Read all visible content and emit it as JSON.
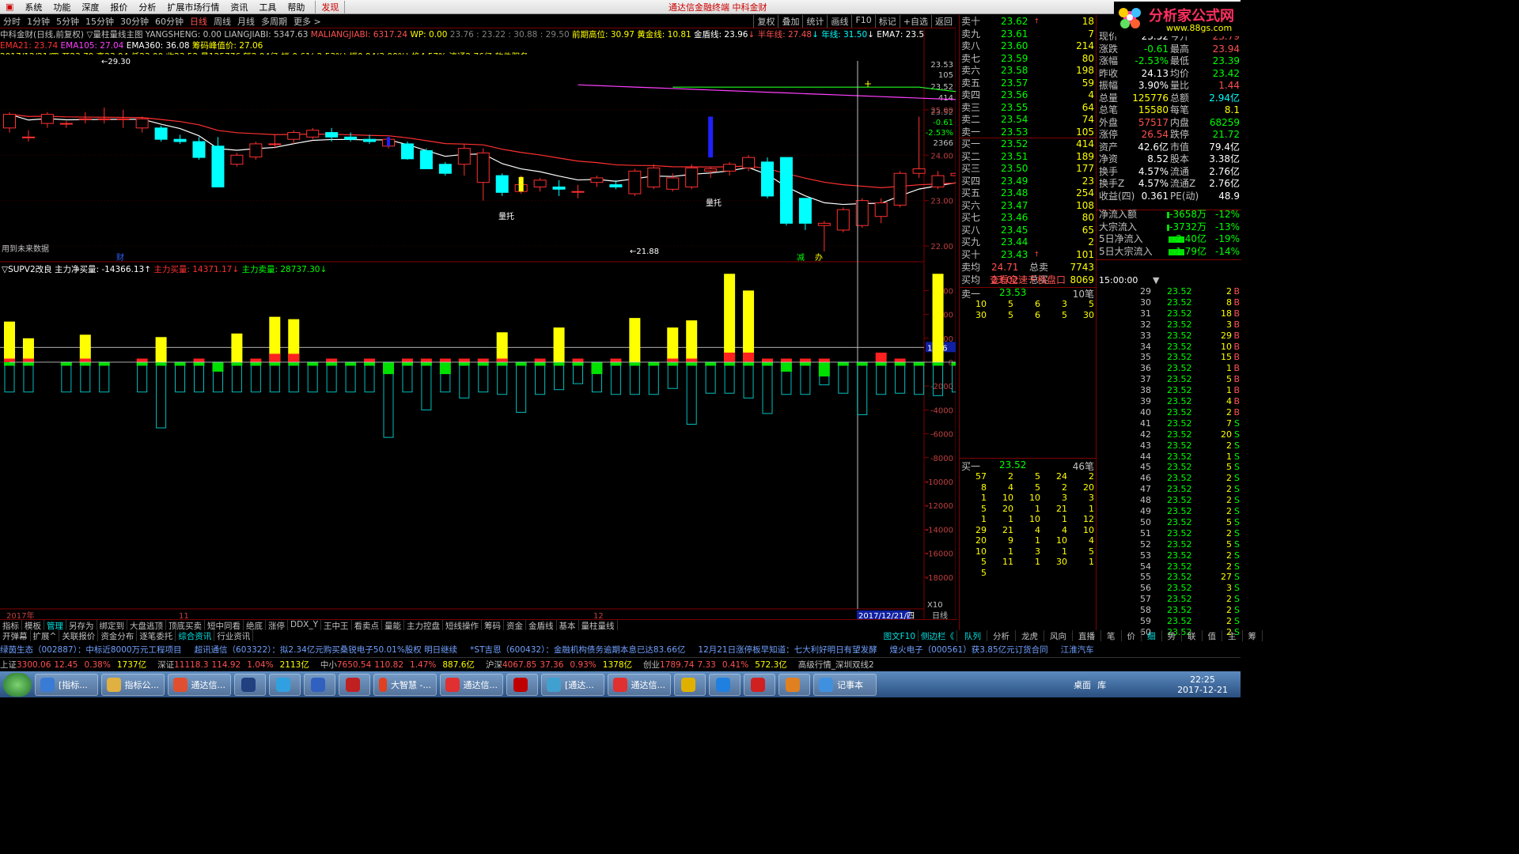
{
  "menu": {
    "items": [
      "系统",
      "功能",
      "深度",
      "报价",
      "分析",
      "扩展市场行情",
      "资讯",
      "工具",
      "帮助"
    ],
    "find": "发现",
    "title": "通达信金融终端  中科金财"
  },
  "period": {
    "items": [
      "分时",
      "1分钟",
      "5分钟",
      "15分钟",
      "30分钟",
      "60分钟",
      "日线",
      "周线",
      "月线",
      "多周期",
      "更多 >"
    ],
    "active": "日线",
    "tools": [
      "复权",
      "叠加",
      "统计",
      "画线",
      "F10",
      "标记",
      "+自选",
      "返回"
    ]
  },
  "info": {
    "line1": [
      {
        "t": "中科金财(日线,前复权) ▽量柱量线主图 YANGSHENG: 0.00  LIANGJIABI: 5347.63",
        "c": "#c0c0c0"
      },
      {
        "t": "  MALIANGJIABI: 6317.24",
        "c": "#ff5050"
      },
      {
        "t": "  WP: 0.00",
        "c": "#ffff00"
      },
      {
        "t": "   23.76 : 23.22 : 30.88 : 29.50",
        "c": "#808080"
      },
      {
        "t": "       前期高位: 30.97",
        "c": "#ffff00"
      },
      {
        "t": "     黄金线: 10.81",
        "c": "#ffff00"
      },
      {
        "t": "       金盾线: 23.96",
        "c": "#ffffff"
      },
      {
        "t": "↓ 半年线: 27.48",
        "c": "#ff5050"
      },
      {
        "t": "↓ 年线: 31.50",
        "c": "#00ffff"
      },
      {
        "t": "↓    EMA7: 23.59",
        "c": "#ffffff"
      },
      {
        "t": "↓ ◇ ◎",
        "c": "#ff5050"
      }
    ],
    "line2": [
      {
        "t": "EMA21: 23.74",
        "c": "#ff3030"
      },
      {
        "t": "   EMA105: 27.04",
        "c": "#ff40ff"
      },
      {
        "t": "   EMA360: 36.08",
        "c": "#ffffff"
      },
      {
        "t": "   筹码峰值价: 27.06",
        "c": "#ffff00"
      }
    ],
    "line3": [
      {
        "t": "2017/12/21/四 开23.79 高23.94 低23.00 收23.52 量125776 额2.94亿 幅-0.61(-2.53%) 振0.94(3.90%) 换4.57% 流通2.76亿 软件服务",
        "c": "#ffff00"
      }
    ]
  },
  "marks": {
    "hi": "←29.30",
    "lo": "←21.88",
    "liangtuo1": "量托",
    "liangtuo2": "量托",
    "future": "用到未来数据",
    "cai": "财",
    "jian": "减",
    "ban": "办"
  },
  "y_main": [
    "23.53",
    "105",
    "23.52",
    "414",
    "23.52",
    "-0.61",
    "-2.53%",
    "2366",
    "25.00",
    "24.00",
    "23.00",
    "22.00"
  ],
  "sub": {
    "title": "▽SUPV2改良  主力净买量: -14366.13↑",
    "buy": "  主力买量: 14371.17↓",
    "sell": "  主力卖量: 28737.30↓",
    "ticks": [
      "6000",
      "4000",
      "2000",
      "0",
      "-2000",
      "-4000",
      "-6000",
      "-8000",
      "-10000",
      "-12000",
      "-14000",
      "-16000",
      "-18000"
    ],
    "cur": "1236",
    "x10": "X10"
  },
  "x_axis": {
    "year": "2017年",
    "m11": "11",
    "m12": "12",
    "date": "2017/12/21/四",
    "day": "日线"
  },
  "chart_data": {
    "type": "candlestick",
    "title": "中科金财(日线,前复权)",
    "open": [
      24.6,
      24.4,
      24.7,
      24.7,
      24.8,
      24.8,
      24.8,
      24.6,
      24.6,
      24.35,
      24.3,
      24.2,
      23.8,
      23.96,
      24.25,
      24.35,
      24.4,
      24.5,
      24.4,
      24.35,
      24.2,
      24.25,
      24.1,
      23.8,
      23.8,
      23.4,
      23.55,
      23.2,
      23.3,
      23.3,
      23.2,
      23.4,
      23.35,
      23.15,
      23.3,
      23.25,
      23.3,
      23.65,
      23.65,
      23.72,
      23.85,
      23.95,
      23.05,
      22.45,
      22.35,
      22.45,
      22.65,
      22.9,
      23.6,
      23.3,
      23.55,
      23.6,
      23.7,
      23.7,
      23.6,
      23.85,
      23.3,
      23.1,
      24.3,
      23.52
    ],
    "close": [
      24.9,
      24.4,
      24.9,
      24.7,
      24.8,
      24.8,
      24.8,
      24.8,
      24.35,
      24.3,
      23.95,
      23.3,
      24,
      24.25,
      24.25,
      24.5,
      24.55,
      24.4,
      24.35,
      24.3,
      24.35,
      23.92,
      23.7,
      23.6,
      24.15,
      24.05,
      23.18,
      23.35,
      23.45,
      23.25,
      23.2,
      23.5,
      23.3,
      23.65,
      23.72,
      23.5,
      23.72,
      23.7,
      23.8,
      23.95,
      23.1,
      22.5,
      22.5,
      22.5,
      22.8,
      23.0,
      22.95,
      23.6,
      23.7,
      23.55,
      23.6,
      23.65,
      23.65,
      23.6,
      23.35,
      23.6,
      22.75,
      23.1,
      24.55,
      23.52
    ],
    "high": [
      24.95,
      24.55,
      24.95,
      24.75,
      24.95,
      25.05,
      25.0,
      24.85,
      24.65,
      24.45,
      24.4,
      24.4,
      24.05,
      24.3,
      24.45,
      24.55,
      24.6,
      24.6,
      24.5,
      24.45,
      24.4,
      24.3,
      24.15,
      23.85,
      24.25,
      24.15,
      23.6,
      23.55,
      23.5,
      23.45,
      23.35,
      23.55,
      23.45,
      23.7,
      23.8,
      23.6,
      23.8,
      23.75,
      23.85,
      24.0,
      23.95,
      23.0,
      22.55,
      22.55,
      22.85,
      23.05,
      23.05,
      23.65,
      24.85,
      23.65,
      24.3,
      23.7,
      23.95,
      23.75,
      23.65,
      23.9,
      23.45,
      24.55,
      24.62,
      23.94
    ],
    "low": [
      24.5,
      24.3,
      24.6,
      24.6,
      24.7,
      24.7,
      24.6,
      24.5,
      24.3,
      24.25,
      23.9,
      23.3,
      23.75,
      23.9,
      24.15,
      24.25,
      24.35,
      24.3,
      24.3,
      24.25,
      24.15,
      23.9,
      23.7,
      23.55,
      23.55,
      23.0,
      23.1,
      23.15,
      23.2,
      23.1,
      23.05,
      23.3,
      23.25,
      23.1,
      23.25,
      23.2,
      23.25,
      23.5,
      23.55,
      23.65,
      23.05,
      22.45,
      22.35,
      21.88,
      22.3,
      22.4,
      22.5,
      22.85,
      23.5,
      23.25,
      23.5,
      23.5,
      23.6,
      23.55,
      23.25,
      23.4,
      22.7,
      22.9,
      23.6,
      23.0
    ],
    "series": [
      {
        "name": "EMA7",
        "color": "#ffffff",
        "ema": 7
      },
      {
        "name": "EMA21",
        "color": "#ff3030",
        "ema": 21
      },
      {
        "name": "EMA105",
        "color": "#ff40ff",
        "values": [
          {
            "from": 30,
            "to": 59,
            "a": 25.55,
            "b": 25.08
          }
        ]
      },
      {
        "name": "金盾线",
        "color": "#20ff20",
        "values": [
          {
            "from": 35,
            "to": 59,
            "a": 25.5,
            "b": 25.08
          }
        ]
      }
    ],
    "sub_buy": [
      3400,
      2000,
      0,
      0,
      2300,
      0,
      0,
      0,
      2100,
      0,
      0,
      0,
      2400,
      0,
      3800,
      3600,
      0,
      0,
      0,
      0,
      0,
      0,
      0,
      0,
      0,
      0,
      2500,
      0,
      0,
      2900,
      0,
      0,
      0,
      3700,
      0,
      2900,
      3500,
      0,
      7400,
      6000,
      0,
      0,
      0,
      0,
      0,
      0,
      0,
      0,
      0,
      7400,
      0,
      0,
      0,
      0,
      0,
      0,
      0,
      0,
      0,
      0
    ],
    "sub_red": [
      300,
      300,
      0,
      0,
      300,
      0,
      0,
      300,
      0,
      0,
      300,
      0,
      0,
      300,
      700,
      700,
      0,
      300,
      0,
      300,
      0,
      300,
      300,
      300,
      300,
      300,
      300,
      0,
      300,
      0,
      300,
      0,
      300,
      0,
      0,
      300,
      300,
      0,
      800,
      800,
      300,
      300,
      300,
      300,
      0,
      0,
      800,
      300,
      0,
      0,
      0,
      0,
      0,
      7400,
      2400,
      1400,
      0,
      0,
      0,
      0
    ],
    "sub_green": [
      -300,
      -300,
      0,
      -300,
      -300,
      -300,
      0,
      -300,
      -300,
      -300,
      -300,
      -800,
      -300,
      -300,
      -300,
      -300,
      -300,
      -300,
      -300,
      -300,
      -1000,
      -300,
      -300,
      -1000,
      -300,
      -300,
      -300,
      -300,
      -300,
      -300,
      -300,
      -1000,
      -300,
      -300,
      -300,
      -300,
      -300,
      -300,
      -300,
      -300,
      -300,
      -800,
      -300,
      -1200,
      -300,
      -300,
      -300,
      -300,
      -300,
      -300,
      -300,
      -300,
      -300,
      -7700,
      -4800,
      -2900,
      0,
      0,
      0,
      0
    ],
    "sub_cyan": [
      -2500,
      -2500,
      0,
      -2500,
      -2500,
      -2500,
      0,
      -2500,
      -5500,
      -2500,
      -2500,
      -2500,
      -2500,
      -2500,
      -2500,
      -2500,
      -2500,
      -2500,
      -2500,
      -2500,
      -6300,
      -2500,
      -4000,
      -2500,
      -3000,
      -2500,
      -2700,
      -4200,
      -2700,
      -2300,
      -1800,
      -2500,
      -2700,
      -2700,
      -2700,
      -2200,
      -5200,
      -2600,
      -2600,
      -3000,
      -4300,
      -2700,
      -2700,
      -1900,
      -2600,
      -4400,
      -2700,
      -2600,
      -2700,
      -2800,
      -2500,
      -2400,
      -4100,
      -20000,
      -13300,
      -12700,
      0,
      0,
      0,
      0
    ]
  },
  "orderbook": {
    "sell": [
      {
        "l": "卖十",
        "p": "23.62",
        "v": "18",
        "f": "†"
      },
      {
        "l": "卖九",
        "p": "23.61",
        "v": "7"
      },
      {
        "l": "卖八",
        "p": "23.60",
        "v": "214"
      },
      {
        "l": "卖七",
        "p": "23.59",
        "v": "80"
      },
      {
        "l": "卖六",
        "p": "23.58",
        "v": "198"
      },
      {
        "l": "卖五",
        "p": "23.57",
        "v": "59"
      },
      {
        "l": "卖四",
        "p": "23.56",
        "v": "4"
      },
      {
        "l": "卖三",
        "p": "23.55",
        "v": "64"
      },
      {
        "l": "卖二",
        "p": "23.54",
        "v": "74"
      },
      {
        "l": "卖一",
        "p": "23.53",
        "v": "105"
      }
    ],
    "buy": [
      {
        "l": "买一",
        "p": "23.52",
        "v": "414"
      },
      {
        "l": "买二",
        "p": "23.51",
        "v": "189"
      },
      {
        "l": "买三",
        "p": "23.50",
        "v": "177"
      },
      {
        "l": "买四",
        "p": "23.49",
        "v": "23"
      },
      {
        "l": "买五",
        "p": "23.48",
        "v": "254"
      },
      {
        "l": "买六",
        "p": "23.47",
        "v": "108"
      },
      {
        "l": "买七",
        "p": "23.46",
        "v": "80"
      },
      {
        "l": "买八",
        "p": "23.45",
        "v": "65"
      },
      {
        "l": "买九",
        "p": "23.44",
        "v": "2"
      },
      {
        "l": "买十",
        "p": "23.43",
        "v": "101",
        "f": "†"
      }
    ],
    "avg": [
      {
        "l": "卖均",
        "p": "24.71",
        "l2": "总卖",
        "v": "7743"
      },
      {
        "l": "买均",
        "p": "23.02",
        "l2": "总买",
        "v": "8069"
      }
    ],
    "link": "查看全速千档盘口",
    "sell1": {
      "label": "卖一",
      "price": "23.53",
      "count": "10笔",
      "rows": [
        [
          "10",
          "5",
          "6",
          "3",
          "5"
        ],
        [
          "30",
          "5",
          "6",
          "5",
          "30"
        ]
      ]
    },
    "buy1": {
      "label": "买一",
      "price": "23.52",
      "count": "46笔",
      "rows": [
        [
          "57",
          "2",
          "5",
          "24",
          "2"
        ],
        [
          "8",
          "4",
          "5",
          "2",
          "20"
        ],
        [
          "1",
          "10",
          "10",
          "3",
          "3"
        ],
        [
          "5",
          "20",
          "1",
          "21",
          "1"
        ],
        [
          "1",
          "1",
          "10",
          "1",
          "12"
        ],
        [
          "29",
          "21",
          "4",
          "4",
          "10"
        ],
        [
          "20",
          "9",
          "1",
          "10",
          "4"
        ],
        [
          "10",
          "1",
          "3",
          "1",
          "5"
        ],
        [
          "5",
          "11",
          "1",
          "30",
          "1"
        ],
        [
          "5",
          "",
          "",
          "",
          ""
        ]
      ]
    }
  },
  "stats": [
    [
      "现价",
      "23.52",
      "#ffffff",
      "今开",
      "23.79",
      "#ff5050"
    ],
    [
      "涨跌",
      "-0.61",
      "#00ff00",
      "最高",
      "23.94",
      "#ff5050"
    ],
    [
      "涨幅",
      "-2.53%",
      "#00ff00",
      "最低",
      "23.39",
      "#00ff00"
    ],
    [
      "昨收",
      "24.13",
      "#ffffff",
      "均价",
      "23.42",
      "#00ff00"
    ],
    [
      "振幅",
      "3.90%",
      "#ffffff",
      "量比",
      "1.44",
      "#ff5050"
    ],
    [
      "总量",
      "125776",
      "#ffff00",
      "总额",
      "2.94亿",
      "#00ffff"
    ],
    [
      "总笔",
      "15580",
      "#ffff00",
      "每笔",
      "8.1",
      "#ffff00"
    ],
    [
      "外盘",
      "57517",
      "#ff5050",
      "内盘",
      "68259",
      "#00ff00"
    ],
    [
      "涨停",
      "26.54",
      "#ff5050",
      "跌停",
      "21.72",
      "#00ff00"
    ],
    [
      "资产",
      "42.6亿",
      "#ffffff",
      "市值",
      "79.4亿",
      "#ffffff"
    ],
    [
      "净资",
      "8.52",
      "#ffffff",
      "股本",
      "3.38亿",
      "#ffffff"
    ],
    [
      "换手",
      "4.57%",
      "#ffffff",
      "流通",
      "2.76亿",
      "#ffffff"
    ],
    [
      "换手Z",
      "4.57%",
      "#ffffff",
      "流通Z",
      "2.76亿",
      "#ffffff"
    ],
    [
      "收益(四)",
      "0.361",
      "#ffffff",
      "PE(动)",
      "48.9",
      "#ffffff"
    ]
  ],
  "flows": [
    [
      "净流入额",
      "-3658万",
      "-12%"
    ],
    [
      "大宗流入",
      "-3732万",
      "-13%"
    ],
    [
      "5日净流入",
      "-2.40亿",
      "-19%"
    ],
    [
      "5日大宗流入",
      "-1.79亿",
      "-14%"
    ]
  ],
  "ticks": {
    "head": "15:00:00",
    "rows": [
      [
        "29",
        "23.52",
        "2",
        "B"
      ],
      [
        "30",
        "23.52",
        "8",
        "B"
      ],
      [
        "31",
        "23.52",
        "18",
        "B"
      ],
      [
        "32",
        "23.52",
        "3",
        "B"
      ],
      [
        "33",
        "23.52",
        "29",
        "B"
      ],
      [
        "34",
        "23.52",
        "10",
        "B"
      ],
      [
        "35",
        "23.52",
        "15",
        "B"
      ],
      [
        "36",
        "23.52",
        "1",
        "B"
      ],
      [
        "37",
        "23.52",
        "5",
        "B"
      ],
      [
        "38",
        "23.52",
        "1",
        "B"
      ],
      [
        "39",
        "23.52",
        "4",
        "B"
      ],
      [
        "40",
        "23.52",
        "2",
        "B"
      ],
      [
        "41",
        "23.52",
        "7",
        "S"
      ],
      [
        "42",
        "23.52",
        "20",
        "S"
      ],
      [
        "43",
        "23.52",
        "2",
        "S"
      ],
      [
        "44",
        "23.52",
        "1",
        "S"
      ],
      [
        "45",
        "23.52",
        "5",
        "S"
      ],
      [
        "46",
        "23.52",
        "2",
        "S"
      ],
      [
        "47",
        "23.52",
        "2",
        "S"
      ],
      [
        "48",
        "23.52",
        "2",
        "S"
      ],
      [
        "49",
        "23.52",
        "2",
        "S"
      ],
      [
        "50",
        "23.52",
        "5",
        "S"
      ],
      [
        "51",
        "23.52",
        "2",
        "S"
      ],
      [
        "52",
        "23.52",
        "5",
        "S"
      ],
      [
        "53",
        "23.52",
        "2",
        "S"
      ],
      [
        "54",
        "23.52",
        "2",
        "S"
      ],
      [
        "55",
        "23.52",
        "27",
        "S"
      ],
      [
        "56",
        "23.52",
        "3",
        "S"
      ],
      [
        "57",
        "23.52",
        "2",
        "S"
      ],
      [
        "58",
        "23.52",
        "2",
        "S"
      ],
      [
        "59",
        "23.52",
        "2",
        "S"
      ],
      [
        "60",
        "23.52",
        "2",
        "S"
      ]
    ]
  },
  "tabs1": [
    "指标",
    "模板",
    "管理",
    "另存为",
    "绑定到",
    "大盘逃顶",
    "顶底买卖",
    "短中同看",
    "绝底",
    "涨停",
    "DDX_Y",
    "王中王",
    "看卖点",
    "量能",
    "主力控盘",
    "短线操作",
    "筹码",
    "资金",
    "金盾线",
    "基本",
    "量柱量线"
  ],
  "tabs2": [
    "开弹幕",
    "扩展^",
    "关联报价",
    "资金分布",
    "逐笔委托",
    "综合资讯",
    "行业资讯"
  ],
  "tabs2r": [
    "图文F10",
    "侧边栏《"
  ],
  "rtabs": [
    "队列",
    "分析",
    "龙虎",
    "风向",
    "直播",
    "笔",
    "价",
    "细",
    "势",
    "联",
    "值",
    "主",
    "筹"
  ],
  "news": [
    "绿茵生态（002887）：中标近8000万元工程项目",
    "超讯通信（603322）：拟2.34亿元购买桑锐电子50.01%股权  明日继续",
    "*ST吉恩（600432）：金融机构债务逾期本息已达83.66亿",
    "12月21日涨停板早知道：七大利好明日有望发酵",
    "煌火电子（000561）获3.85亿元订货合同",
    "江淮汽车"
  ],
  "index": [
    {
      "n": "上证",
      "v": "3300.06",
      "d": "12.45",
      "p": "0.38%",
      "a": "1737亿"
    },
    {
      "n": "深证",
      "v": "11118.3",
      "d": "114.92",
      "p": "1.04%",
      "a": "2113亿"
    },
    {
      "n": "中小",
      "v": "7650.54",
      "d": "110.82",
      "p": "1.47%",
      "a": "887.6亿"
    },
    {
      "n": "沪深",
      "v": "4067.85",
      "d": "37.36",
      "p": "0.93%",
      "a": "1378亿"
    },
    {
      "n": "创业",
      "v": "1789.74",
      "d": "7.33",
      "p": "0.41%",
      "a": "572.3亿"
    }
  ],
  "index_tail": "高级行情_深圳双线2",
  "taskbar": {
    "apps": [
      {
        "label": "[指标...",
        "c": "#3a7bd5"
      },
      {
        "label": "指标公...",
        "c": "#e0b040"
      },
      {
        "label": "通达信...",
        "c": "#e05030"
      },
      {
        "label": "",
        "c": "#204080"
      },
      {
        "label": "",
        "c": "#30a0e0"
      },
      {
        "label": "",
        "c": "#3060c0"
      },
      {
        "label": "",
        "c": "#c02020"
      },
      {
        "label": "大智慧 -...",
        "c": "#e04020"
      },
      {
        "label": "通达信...",
        "c": "#e03030"
      },
      {
        "label": "",
        "c": "#c00000"
      },
      {
        "label": "[通达...",
        "c": "#40a0d0"
      },
      {
        "label": "通达信...",
        "c": "#e03030"
      },
      {
        "label": "",
        "c": "#e0b000"
      },
      {
        "label": "",
        "c": "#2080e0"
      },
      {
        "label": "",
        "c": "#d02020"
      },
      {
        "label": "",
        "c": "#e08020"
      },
      {
        "label": "记事本",
        "c": "#4090e0"
      }
    ],
    "desk": "桌面",
    "lib": "库",
    "time": "22:25",
    "date": "2017-12-21"
  },
  "logo": {
    "text": "分析家公式网",
    "url": "www.88gs.com"
  }
}
